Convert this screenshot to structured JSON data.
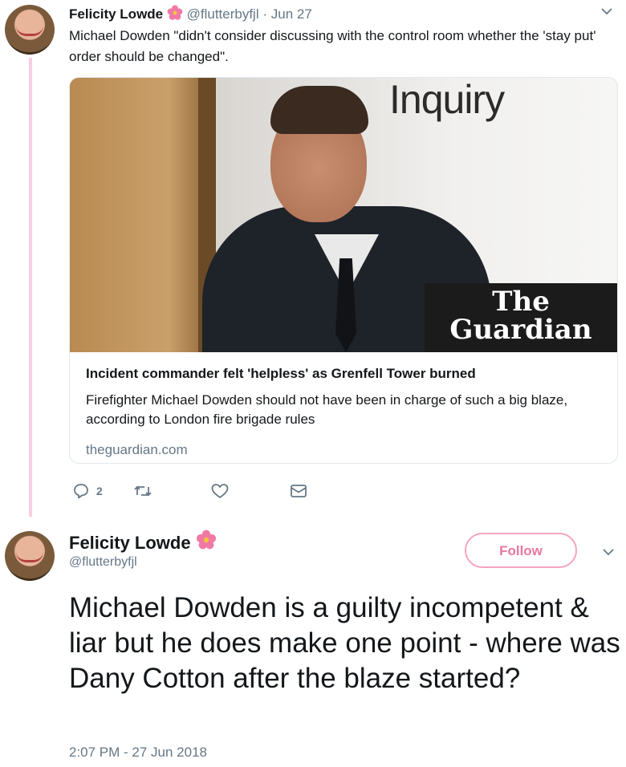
{
  "tweet1": {
    "author_name": "Felicity Lowde",
    "author_handle": "@flutterbyfjl",
    "separator": "·",
    "date": "Jun 27",
    "text": "Michael Dowden \"didn't consider discussing with the control room whether the 'stay put' order should be changed\".",
    "card": {
      "image_text": "Inquiry",
      "logo_line1": "The",
      "logo_line2": "Guardian",
      "title": "Incident commander felt 'helpless' as Grenfell Tower burned",
      "description": "Firefighter Michael Dowden should not have been in charge of such a big blaze, according to London fire brigade rules",
      "domain": "theguardian.com"
    },
    "actions": {
      "reply_count": "2",
      "retweet_icon": "retweet-icon",
      "like_icon": "heart-icon",
      "dm_icon": "envelope-icon"
    }
  },
  "tweet2": {
    "author_name": "Felicity Lowde",
    "author_handle": "@flutterbyfjl",
    "follow_label": "Follow",
    "text": "Michael Dowden is a guilty incompetent & liar but he does make one point - where was Dany Cotton after the blaze started?",
    "timestamp": "2:07 PM - 27 Jun 2018"
  },
  "colors": {
    "thread_line": "#f7cfe0",
    "follow_accent": "#e8779f",
    "muted_text": "#657786"
  }
}
